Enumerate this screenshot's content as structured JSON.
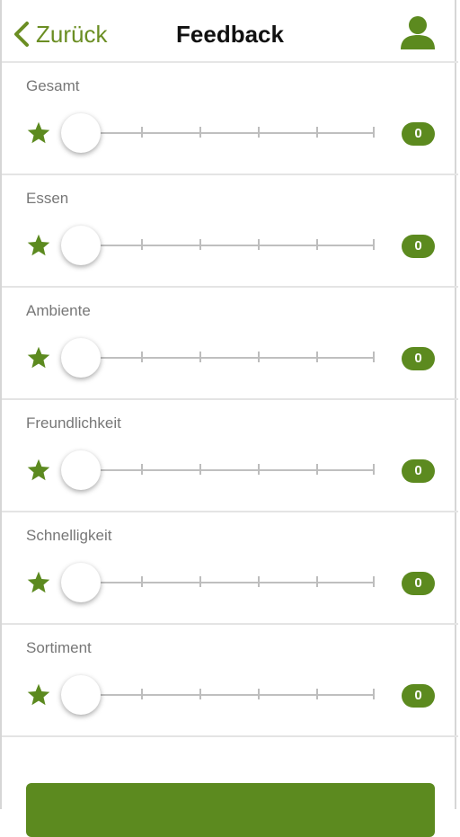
{
  "header": {
    "back_label": "Zurück",
    "title": "Feedback",
    "back_icon": "chevron-left-icon",
    "user_icon": "user-icon"
  },
  "accent_color": "#5c8a1f",
  "ratings": [
    {
      "label": "Gesamt",
      "value": "0"
    },
    {
      "label": "Essen",
      "value": "0"
    },
    {
      "label": "Ambiente",
      "value": "0"
    },
    {
      "label": "Freundlichkeit",
      "value": "0"
    },
    {
      "label": "Schnelligkeit",
      "value": "0"
    },
    {
      "label": "Sortiment",
      "value": "0"
    }
  ],
  "slider": {
    "min": 0,
    "max": 5
  },
  "submit_label": ""
}
